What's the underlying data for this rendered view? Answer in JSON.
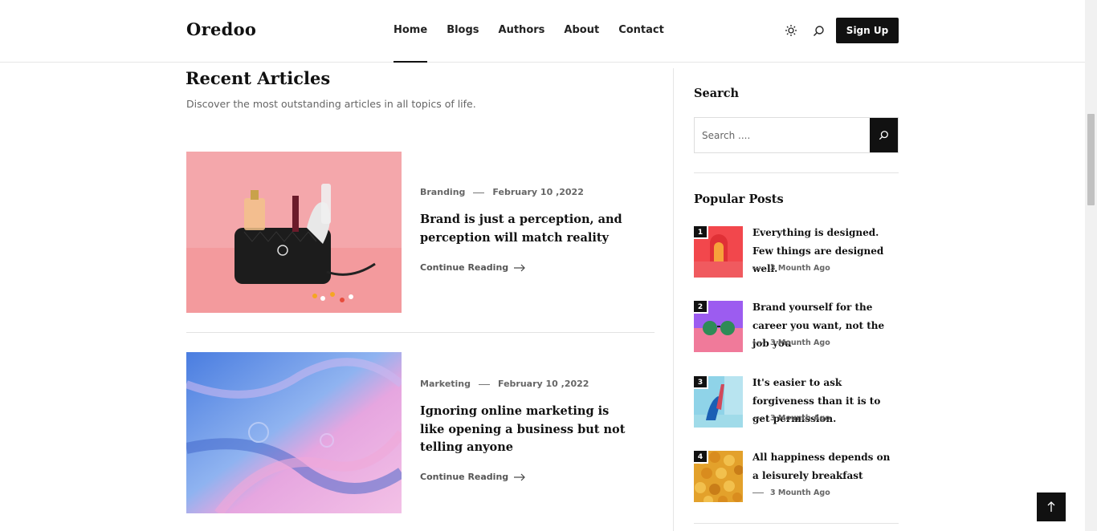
{
  "header": {
    "logo": "Oredoo",
    "nav": [
      {
        "label": "Home",
        "active": true
      },
      {
        "label": "Blogs",
        "active": false
      },
      {
        "label": "Authors",
        "active": false
      },
      {
        "label": "About",
        "active": false
      },
      {
        "label": "Contact",
        "active": false
      }
    ],
    "theme_icon": "sun-icon",
    "search_icon": "search-icon",
    "signup_label": "Sign Up"
  },
  "main": {
    "title": "Recent Articles",
    "subtitle": "Discover the most outstanding articles in all topics of life.",
    "articles": [
      {
        "category": "Branding",
        "date": "February 10 ,2022",
        "title": "Brand is just a perception, and perception will match reality",
        "read_more": "Continue Reading",
        "image": "cosmetics-bag-on-pink"
      },
      {
        "category": "Marketing",
        "date": "February 10 ,2022",
        "title": "Ignoring online marketing is like opening a business but not telling anyone",
        "read_more": "Continue Reading",
        "image": "blue-pink-fluid-art"
      }
    ]
  },
  "sidebar": {
    "search_heading": "Search",
    "search_placeholder": "Search ....",
    "popular_heading": "Popular Posts",
    "popular": [
      {
        "num": "1",
        "title": "Everything is designed. Few things are designed well.",
        "time": "3 Mounth Ago"
      },
      {
        "num": "2",
        "title": "Brand yourself for the career you want, not the job you",
        "time": "3 Mounth Ago"
      },
      {
        "num": "3",
        "title": "It's easier to ask forgiveness than it is to get permission.",
        "time": "3 Mounth Ago"
      },
      {
        "num": "4",
        "title": "All happiness depends on a leisurely breakfast",
        "time": "3 Mounth Ago"
      }
    ]
  },
  "colors": {
    "accent": "#111111",
    "muted": "#666666",
    "border": "#e3e3e3"
  }
}
